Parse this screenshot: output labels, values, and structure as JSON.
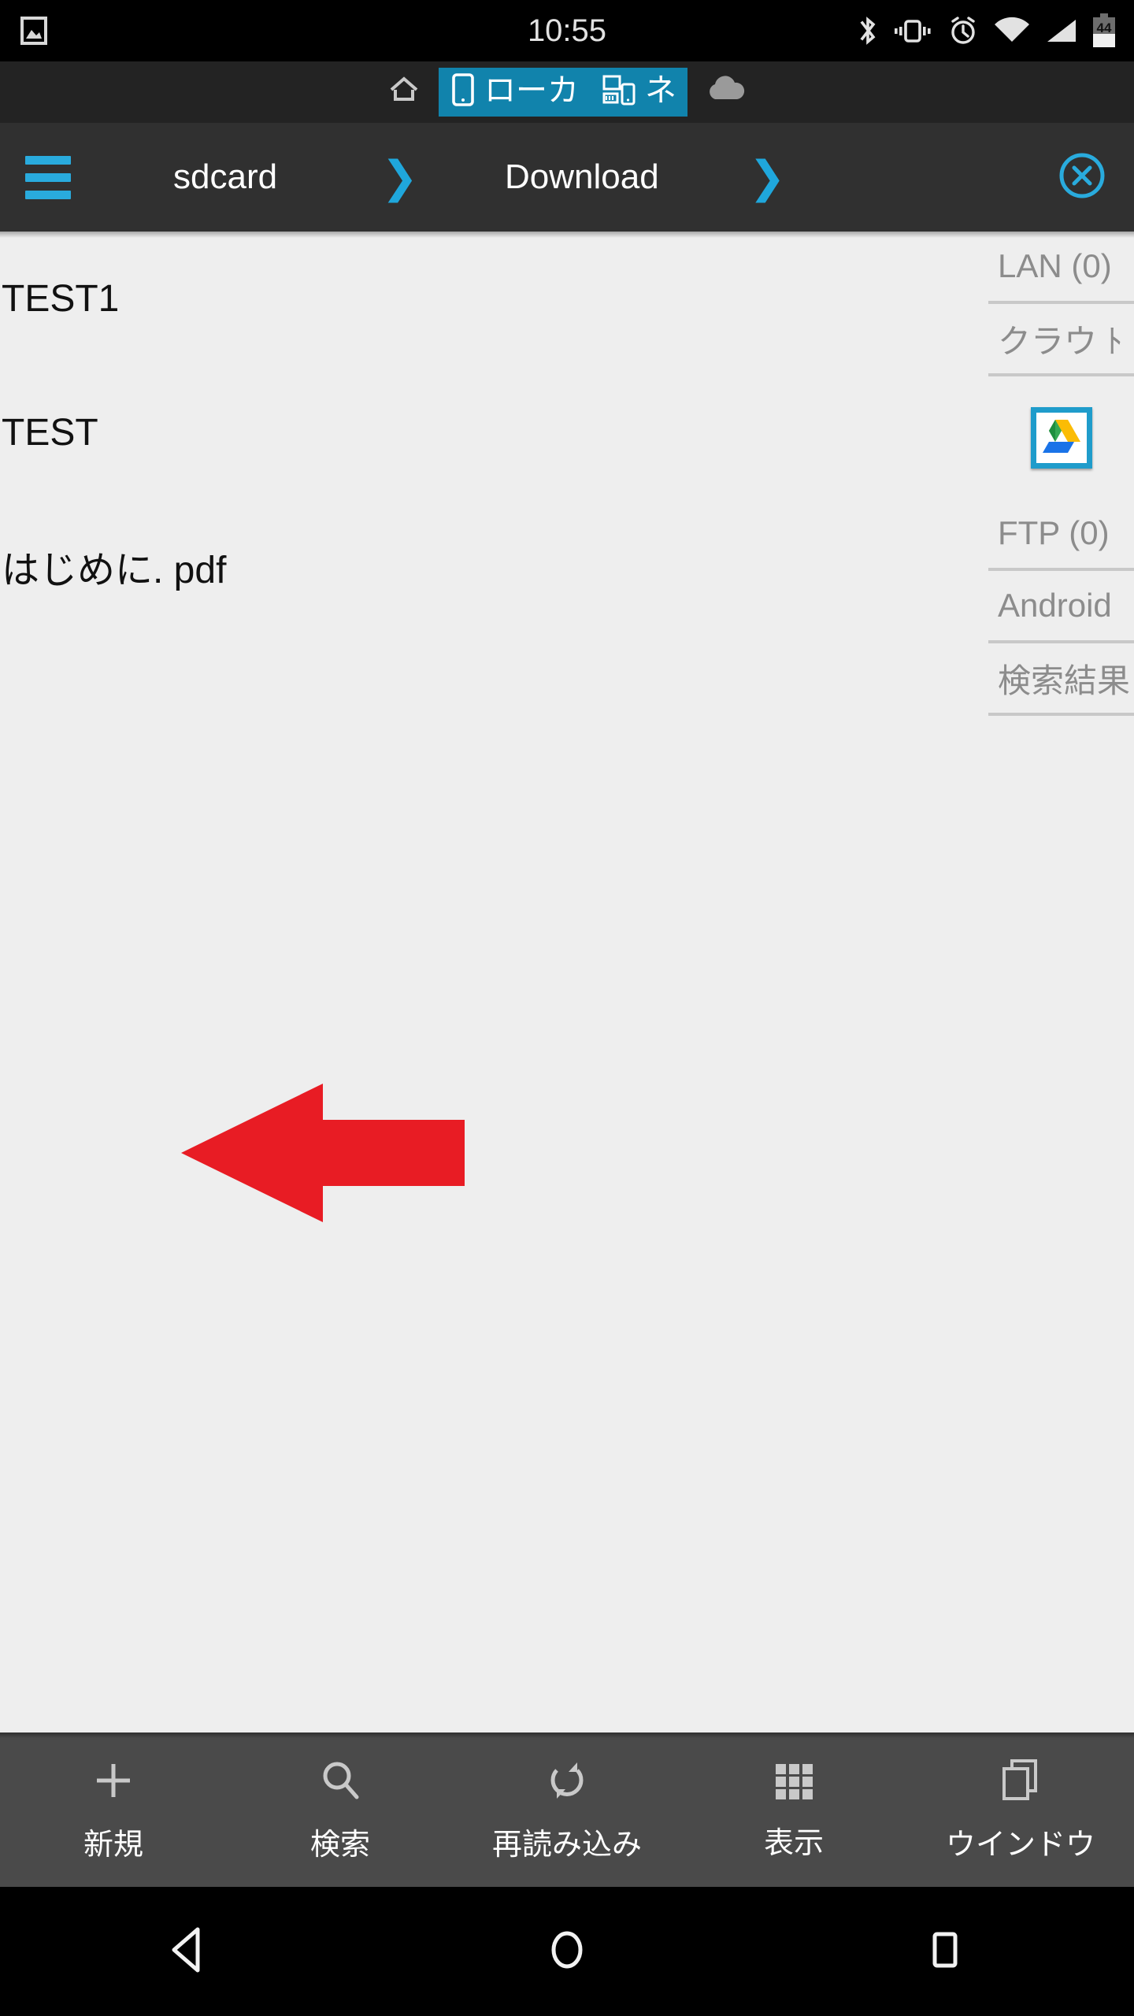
{
  "status_bar": {
    "time": "10:55",
    "battery_level": "44",
    "icons": {
      "notification": "image-icon",
      "bluetooth": "bluetooth-icon",
      "vibrate": "vibrate-icon",
      "alarm": "alarm-icon",
      "wifi": "wifi-icon",
      "signal": "signal-icon",
      "battery": "battery-icon"
    }
  },
  "tab_strip": {
    "tabs": [
      {
        "label": "",
        "icon": "home-icon",
        "active": false
      },
      {
        "label": "ローカ",
        "icon": "phone-icon",
        "active": true
      },
      {
        "label": "ネ",
        "icon": "network-devices-icon",
        "active": true
      },
      {
        "label": "",
        "icon": "cloud-icon",
        "active": false
      }
    ]
  },
  "breadcrumb": {
    "menu_icon": "hamburger-icon",
    "crumbs": [
      "sdcard",
      "Download"
    ],
    "separator": "❯",
    "close_icon": "close-circle-icon"
  },
  "file_list": {
    "items": [
      {
        "name": "TEST1"
      },
      {
        "name": "TEST"
      },
      {
        "name": "はじめに. pdf"
      }
    ]
  },
  "side_panel": {
    "items": [
      {
        "label": "LAN (0)",
        "type": "text"
      },
      {
        "label": "クラウ ﾄ",
        "type": "text"
      },
      {
        "label": "",
        "type": "icon",
        "icon": "google-drive-icon"
      },
      {
        "label": "FTP (0)",
        "type": "text"
      },
      {
        "label": "Android",
        "type": "text"
      },
      {
        "label": "検索結果",
        "type": "text"
      }
    ]
  },
  "annotation": {
    "arrow_direction": "left",
    "arrow_color": "#E81C24"
  },
  "toolbar": {
    "items": [
      {
        "label": "新規",
        "icon": "plus-icon"
      },
      {
        "label": "検索",
        "icon": "search-icon"
      },
      {
        "label": "再読み込み",
        "icon": "refresh-icon"
      },
      {
        "label": "表示",
        "icon": "grid-icon"
      },
      {
        "label": "ウインドウ",
        "icon": "windows-icon"
      }
    ]
  },
  "nav_bar": {
    "buttons": [
      {
        "name": "back",
        "icon": "back-triangle-icon"
      },
      {
        "name": "home",
        "icon": "home-circle-icon"
      },
      {
        "name": "recents",
        "icon": "recents-square-icon"
      }
    ]
  },
  "colors": {
    "accent_blue": "#29ABDD",
    "tab_blue": "#1183AC",
    "background": "#EEEEEE",
    "toolbar_bg": "#4A4A4A",
    "crumbbar_bg": "#303030"
  }
}
